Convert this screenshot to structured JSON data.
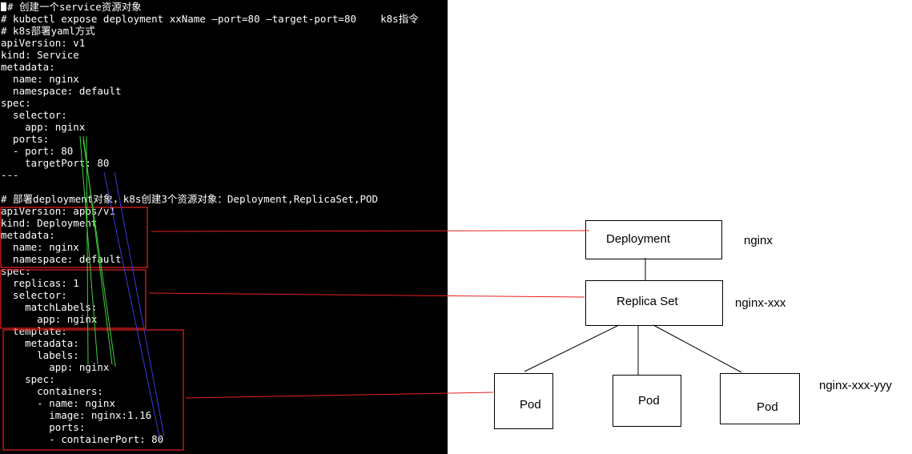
{
  "terminal": {
    "lines": [
      "# 创建一个service资源对象",
      "# kubectl expose deployment xxName –port=80 –target-port=80    k8s指令",
      "# k8s部署yaml方式",
      "apiVersion: v1",
      "kind: Service",
      "metadata:",
      "  name: nginx",
      "  namespace: default",
      "spec:",
      "  selector:",
      "    app: nginx",
      "  ports:",
      "  - port: 80",
      "    targetPort: 80",
      "---",
      "",
      "# 部署deployment对象，k8s创建3个资源对象：Deployment,ReplicaSet,POD",
      "apiVersion: apps/v1",
      "kind: Deployment",
      "metadata:",
      "  name: nginx",
      "  namespace: default",
      "spec:",
      "  replicas: 1",
      "  selector:",
      "    matchLabels:",
      "      app: nginx",
      "  template:",
      "    metadata:",
      "      labels:",
      "        app: nginx",
      "    spec:",
      "      containers:",
      "      - name: nginx",
      "        image: nginx:1.16",
      "        ports:",
      "        - containerPort: 80"
    ]
  },
  "diagram": {
    "deployment_box": "Deployment",
    "replicaset_box": "Replica Set",
    "pod_boxes": [
      "Pod",
      "Pod",
      "Pod"
    ],
    "deployment_name": "nginx",
    "replicaset_name": "nginx-xxx",
    "pod_name": "nginx-xxx-yyy"
  },
  "colors": {
    "terminal_bg": "#000000",
    "terminal_text": "#ffffff",
    "highlight_red": "#e8211e",
    "link_green": "#3fcf3f",
    "link_blue": "#3a3ae0"
  }
}
